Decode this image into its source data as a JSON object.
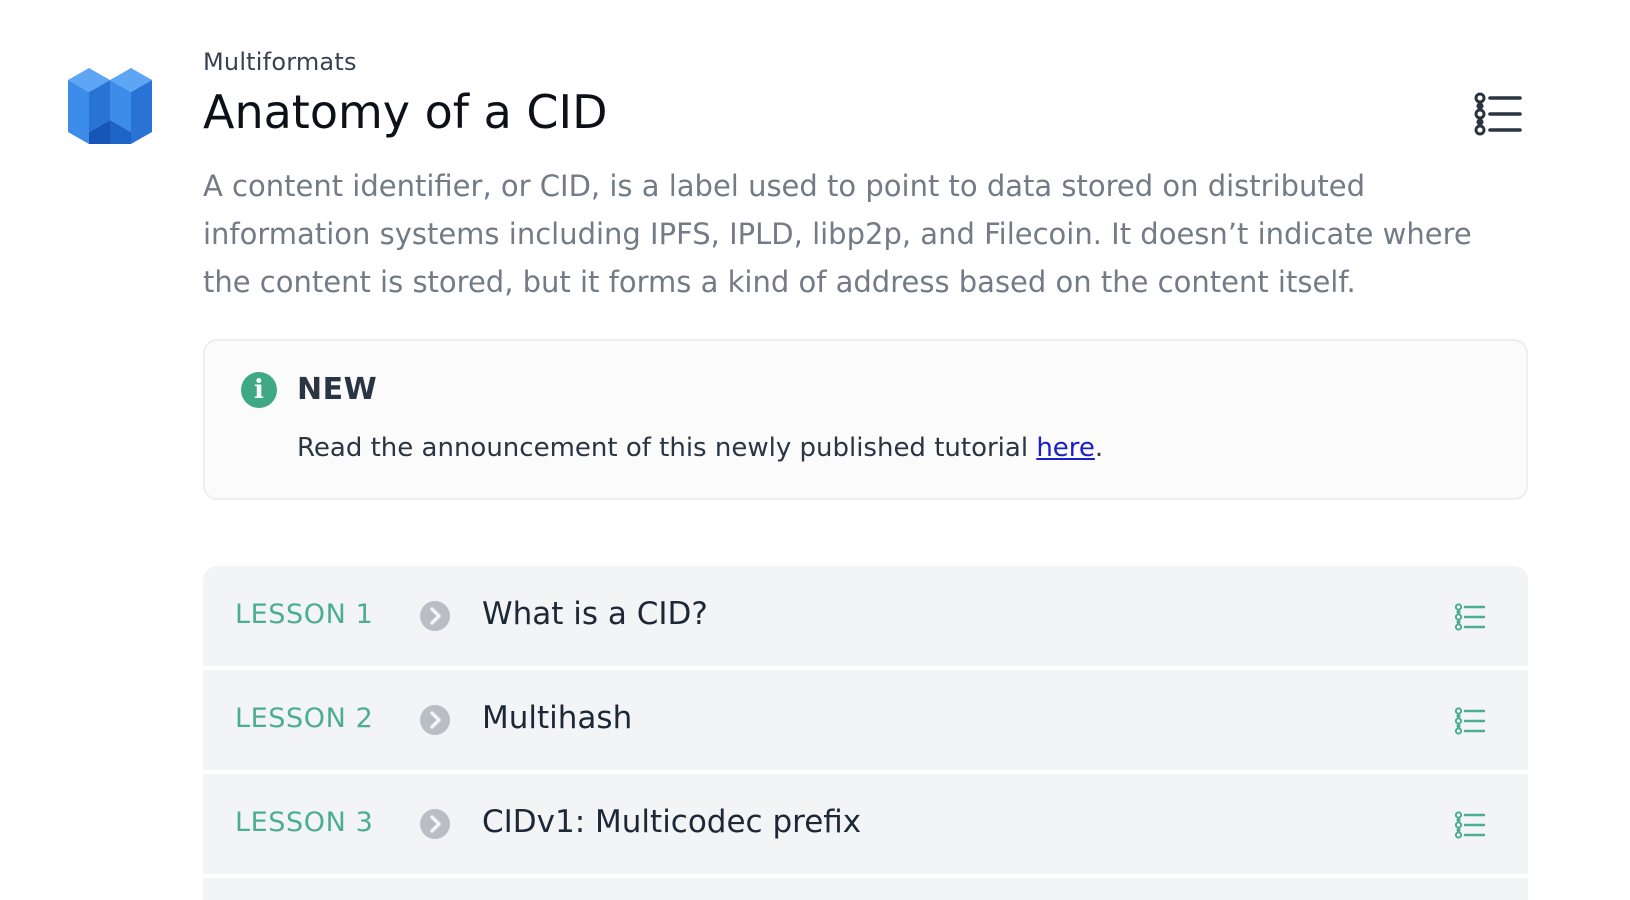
{
  "brand": {
    "name": "Multiformats",
    "logo_icon": "multiformats-cube-logo",
    "colors": {
      "logo_light": "#4f9bf0",
      "logo_mid": "#2f7de1",
      "logo_dark": "#1556b8"
    }
  },
  "header": {
    "eyebrow": "Multiformats",
    "title": "Anatomy of a CID",
    "toc_icon": "list-icon"
  },
  "description": "A content identifier, or CID, is a label used to point to data stored on distributed information systems including IPFS, IPLD, libp2p, and Filecoin. It doesn’t indicate where the content is stored, but it forms a kind of address based on the content itself.",
  "callout": {
    "icon": "info-icon",
    "icon_glyph": "i",
    "title": "NEW",
    "text_before": "Read the announcement of this newly published tutorial ",
    "link_text": "here",
    "text_after": ".",
    "accent_color": "#3fa884"
  },
  "lessons": [
    {
      "label": "LESSON 1",
      "title": "What is a CID?"
    },
    {
      "label": "LESSON 2",
      "title": "Multihash"
    },
    {
      "label": "LESSON 3",
      "title": "CIDv1: Multicodec prefix"
    }
  ],
  "colors": {
    "lesson_label": "#4caf8c",
    "lesson_row_bg": "#f2f4f6",
    "arrow_circle": "#b9bec4",
    "link": "#1a1fc9"
  }
}
